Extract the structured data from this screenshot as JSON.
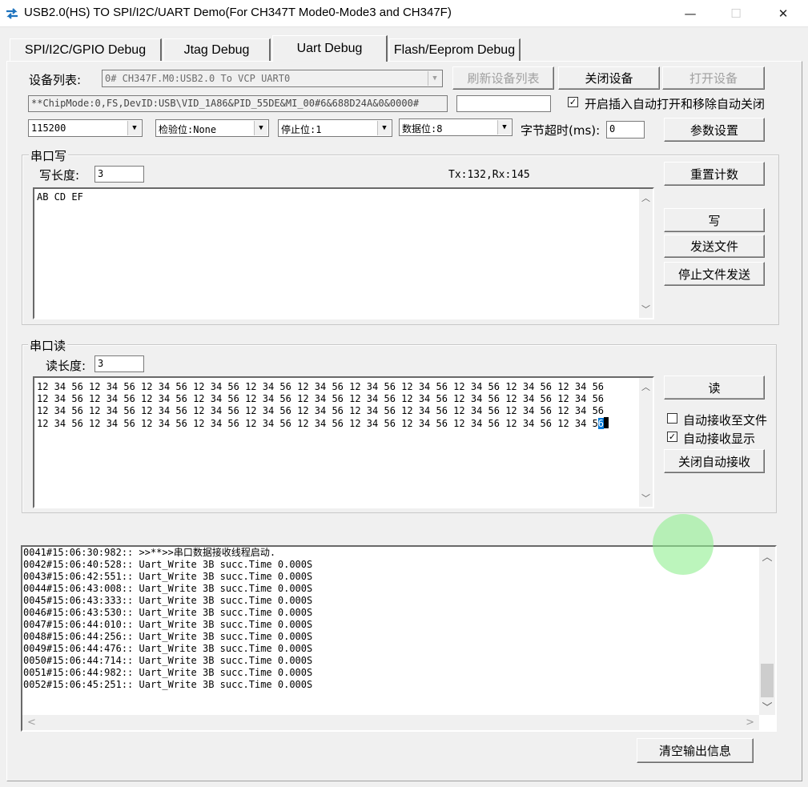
{
  "window": {
    "title": "USB2.0(HS) TO SPI/I2C/UART Demo(For CH347T Mode0-Mode3 and CH347F)",
    "minimize": "—",
    "maximize": "☐",
    "close": "✕"
  },
  "tabs": [
    {
      "label": "SPI/I2C/GPIO Debug",
      "active": false
    },
    {
      "label": "Jtag Debug",
      "active": false
    },
    {
      "label": "Uart Debug",
      "active": true
    },
    {
      "label": "Flash/Eeprom Debug",
      "active": false
    }
  ],
  "device": {
    "list_label": "设备列表:",
    "selected_device": "0# CH347F.M0:USB2.0 To VCP UART0",
    "refresh_button": "刷新设备列表",
    "close_button": "关闭设备",
    "open_button": "打开设备",
    "chip_info": "**ChipMode:0,FS,DevID:USB\\VID_1A86&PID_55DE&MI_00#6&688D24A&0&0000#",
    "extra_field": "",
    "auto_open_checkbox": {
      "label": "开启插入自动打开和移除自动关闭",
      "checked": true
    }
  },
  "params": {
    "baud": "115200",
    "parity": "检验位:None",
    "stop_bits": "停止位:1",
    "data_bits": "数据位:8",
    "timeout_label": "字节超时(ms):",
    "timeout_value": "0",
    "set_button": "参数设置"
  },
  "write_group": {
    "title": "串口写",
    "length_label": "写长度:",
    "length_value": "3",
    "counters": "Tx:132,Rx:145",
    "reset_button": "重置计数",
    "content": "AB CD EF",
    "write_button": "写",
    "send_file_button": "发送文件",
    "stop_file_button": "停止文件发送"
  },
  "read_group": {
    "title": "串口读",
    "length_label": "读长度:",
    "length_value": "3",
    "lines": [
      "12 34 56 12 34 56 12 34 56 12 34 56 12 34 56 12 34 56 12 34 56 12 34 56 12 34 56 12 34 56 12 34 56",
      "12 34 56 12 34 56 12 34 56 12 34 56 12 34 56 12 34 56 12 34 56 12 34 56 12 34 56 12 34 56 12 34 56",
      "12 34 56 12 34 56 12 34 56 12 34 56 12 34 56 12 34 56 12 34 56 12 34 56 12 34 56 12 34 56 12 34 56"
    ],
    "last_line_prefix": "12 34 56 12 34 56 12 34 56 12 34 56 12 34 56 12 34 56 12 34 56 12 34 56 12 34 56 12 34 56 12 34 5",
    "last_line_selected": "6",
    "read_button": "读",
    "auto_save_checkbox": {
      "label": "自动接收至文件",
      "checked": false
    },
    "auto_show_checkbox": {
      "label": "自动接收显示",
      "checked": true
    },
    "close_auto_button": "关闭自动接收"
  },
  "log": {
    "lines": [
      "0041#15:06:30:982:: >>**>>串口数据接收线程启动.",
      "0042#15:06:40:528:: Uart_Write 3B succ.Time 0.000S",
      "0043#15:06:42:551:: Uart_Write 3B succ.Time 0.000S",
      "0044#15:06:43:008:: Uart_Write 3B succ.Time 0.000S",
      "0045#15:06:43:333:: Uart_Write 3B succ.Time 0.000S",
      "0046#15:06:43:530:: Uart_Write 3B succ.Time 0.000S",
      "0047#15:06:44:010:: Uart_Write 3B succ.Time 0.000S",
      "0048#15:06:44:256:: Uart_Write 3B succ.Time 0.000S",
      "0049#15:06:44:476:: Uart_Write 3B succ.Time 0.000S",
      "0050#15:06:44:714:: Uart_Write 3B succ.Time 0.000S",
      "0051#15:06:44:982:: Uart_Write 3B succ.Time 0.000S",
      "0052#15:06:45:251:: Uart_Write 3B succ.Time 0.000S"
    ],
    "clear_button": "清空输出信息"
  },
  "icons": {
    "app": "usb-transfer-arrows-icon",
    "combo_arrow": "▼",
    "scroll_up": "︿",
    "scroll_down": "﹀",
    "scroll_left": "<",
    "scroll_right": ">",
    "check": "✓"
  },
  "colors": {
    "accent": "#0078d7",
    "app_icon": "#1e73be",
    "click_indicator": "#90ee90"
  }
}
